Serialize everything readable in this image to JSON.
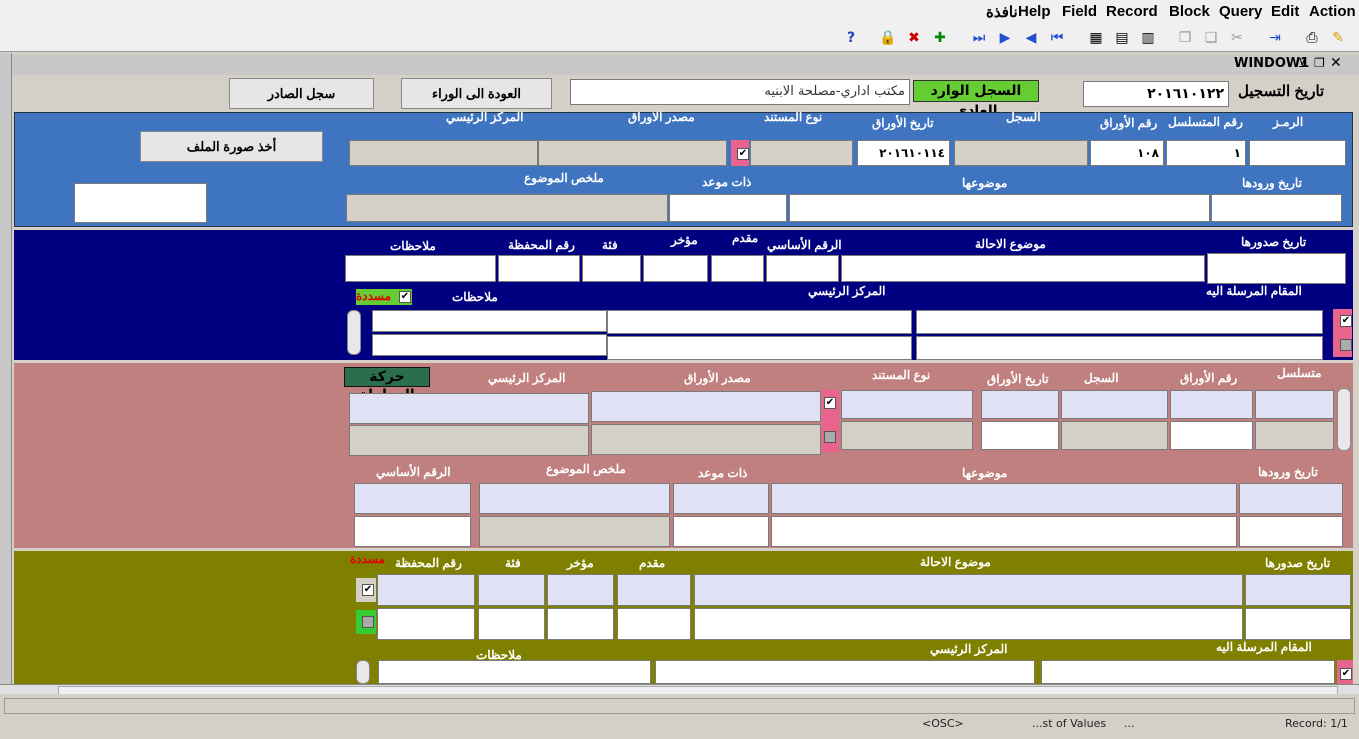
{
  "menu": {
    "action": "Action",
    "edit": "Edit",
    "query": "Query",
    "block": "Block",
    "record": "Record",
    "field": "Field",
    "help": "Help",
    "window": "نافذة"
  },
  "window": {
    "title": "WINDOW1"
  },
  "header": {
    "reg_date_label": "تاريخ التسجيل",
    "reg_date_value": "٢٠١٦١٠١٢٢",
    "register_type": "السجل الوارد العادي",
    "office_value": "مكتب اداري-مصلحة الابنيه",
    "back_button": "العودة الى الوراء",
    "outgoing_button": "سجل الصادر"
  },
  "blue_block": {
    "labels": {
      "code": "الرمـز",
      "serial": "رقم المتسلسل",
      "papers_no": "رقم الأوراق",
      "register": "السجل",
      "papers_date": "تاريخ الأوراق",
      "doc_type": "نوع المستند",
      "papers_source": "مصدر الاوراق",
      "main_center": "المركز الرئيسي",
      "arrival_date": "تاريخ ورودها",
      "subject": "موضوعها",
      "deadline": "ذات موعد",
      "summary": "ملخص الموضوع"
    },
    "values": {
      "serial": "١",
      "papers_no": "١٠٨",
      "papers_date": "٢٠١٦١٠١١٤"
    },
    "file_image_button": "أخذ صورة الملف"
  },
  "navy_block": {
    "labels": {
      "issue_date": "تاريخ صدورها",
      "referral_subject": "موضوع الاحالة",
      "basic_no": "الرقم الأساسي",
      "advance": "مقدم",
      "late": "مؤخر",
      "category": "فئة",
      "portfolio_no": "رقم المحفظة",
      "notes": "ملاحظات",
      "sent_to": "المقام المرسلة اليه",
      "main_center": "المركز الرئيسي",
      "notes2": "ملاحظات",
      "paid": "مسددة"
    }
  },
  "pink_block": {
    "labels": {
      "serial": "متسلسل",
      "papers_no": "رقم الأوراق",
      "register": "السجل",
      "papers_date": "تاريخ الأوراق",
      "doc_type": "نوع المستند",
      "papers_source": "مصدر الأوراق",
      "main_center": "المركز الرئيسي",
      "transaction_movement": "حركة المعاملة",
      "arrival_date": "تاريخ ورودها",
      "subject": "موضوعها",
      "deadline": "ذات موعد",
      "summary": "ملخص الموضوع",
      "basic_no": "الرقم الأساسي"
    }
  },
  "olive_block": {
    "labels": {
      "issue_date": "تاريخ صدورها",
      "referral_subject": "موضوع الاحالة",
      "advance": "مقدم",
      "late": "مؤخر",
      "category": "فئة",
      "portfolio_no": "رقم المحفظة",
      "paid": "مسددة",
      "sent_to": "المقام المرسلة اليه",
      "main_center": "المركز الرئيسي",
      "notes": "ملاحظات"
    }
  },
  "status": {
    "osc": "<OSC>",
    "list_of_values": "...st of Values",
    "ellipsis": "...",
    "record": "Record: 1/1"
  },
  "colors": {
    "blue_block": "#3e74c0",
    "navy_block": "#000080",
    "pink_block": "#c08080",
    "olive_block": "#808000",
    "accent_pink": "#e8648c",
    "green_label": "#66cc33"
  }
}
